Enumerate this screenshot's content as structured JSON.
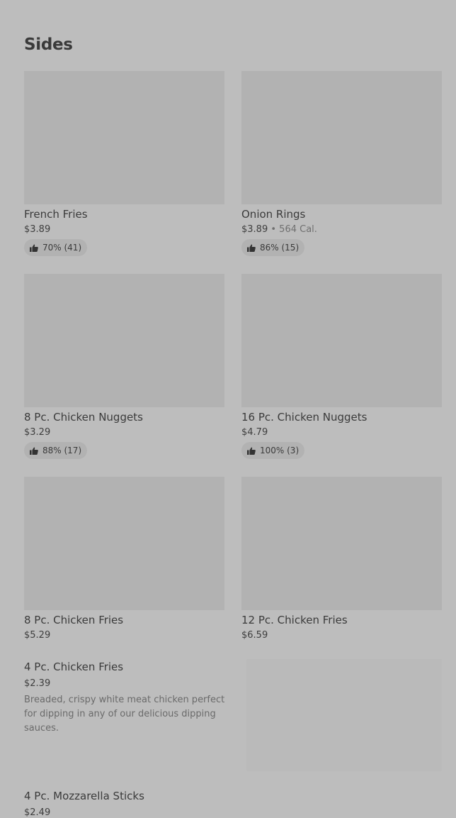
{
  "section": {
    "title": "Sides"
  },
  "items": [
    {
      "name": "French Fries",
      "price": "$3.89",
      "calories": "",
      "rating": "70% (41)"
    },
    {
      "name": "Onion Rings",
      "price": "$3.89",
      "calories": "564 Cal.",
      "rating": "86% (15)"
    },
    {
      "name": "8 Pc. Chicken Nuggets",
      "price": "$3.29",
      "calories": "",
      "rating": "88% (17)"
    },
    {
      "name": "16 Pc. Chicken Nuggets",
      "price": "$4.79",
      "calories": "",
      "rating": "100% (3)"
    },
    {
      "name": "8 Pc. Chicken Fries",
      "price": "$5.29",
      "calories": "",
      "rating": ""
    },
    {
      "name": "12 Pc. Chicken Fries",
      "price": "$6.59",
      "calories": "",
      "rating": ""
    }
  ],
  "featured": [
    {
      "name": "4 Pc. Chicken Fries",
      "price": "$2.39",
      "description": "Breaded, crispy white meat chicken perfect for dipping in any of our delicious dipping sauces."
    },
    {
      "name": "4 Pc. Mozzarella Sticks",
      "price": "$2.49"
    }
  ],
  "separator": "•",
  "icons": {
    "rating": "thumbs-up-icon"
  }
}
